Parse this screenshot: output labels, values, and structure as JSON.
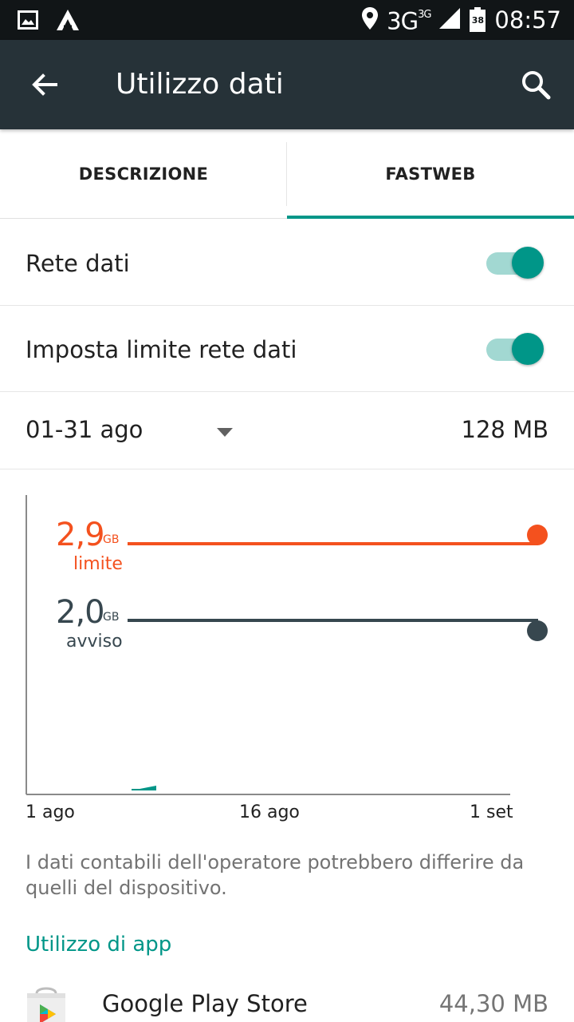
{
  "status_bar": {
    "network": "3G",
    "network_sup": "3G",
    "battery_level": "38",
    "time": "08:57",
    "icons": [
      "image-icon",
      "autodesk-icon",
      "location-icon",
      "signal-icon",
      "battery-icon"
    ]
  },
  "app_bar": {
    "title": "Utilizzo dati",
    "back_icon": "arrow-left-icon",
    "search_icon": "search-icon",
    "color": "#263238"
  },
  "tabs": [
    {
      "label": "DESCRIZIONE",
      "selected": false
    },
    {
      "label": "FASTWEB",
      "selected": true
    }
  ],
  "settings": {
    "mobile_data": {
      "label": "Rete dati",
      "enabled": true
    },
    "data_limit": {
      "label": "Imposta limite rete dati",
      "enabled": true
    }
  },
  "cycle": {
    "period": "01-31 ago",
    "total": "128 MB"
  },
  "chart": {
    "limit": {
      "value": "2,9",
      "unit": "GB",
      "caption": "limite",
      "color": "#f4511e"
    },
    "warning": {
      "value": "2,0",
      "unit": "GB",
      "caption": "avviso",
      "color": "#37474f"
    },
    "x_labels": [
      "1 ago",
      "16 ago",
      "1 set"
    ]
  },
  "chart_data": {
    "type": "area",
    "x": [
      "1 ago",
      "16 ago",
      "1 set"
    ],
    "series": [
      {
        "values": [
          0,
          0.128,
          0.128
        ]
      }
    ],
    "limit_gb": 2.9,
    "warning_gb": 2.0,
    "accent": "#009688"
  },
  "note": "I dati contabili dell'operatore potrebbero differire da quelli del dispositivo.",
  "app_usage": {
    "title": "Utilizzo di app",
    "items": [
      {
        "name": "Google Play Store",
        "size": "44,30 MB",
        "icon": "play-store-icon"
      }
    ]
  },
  "accent": "#009688"
}
